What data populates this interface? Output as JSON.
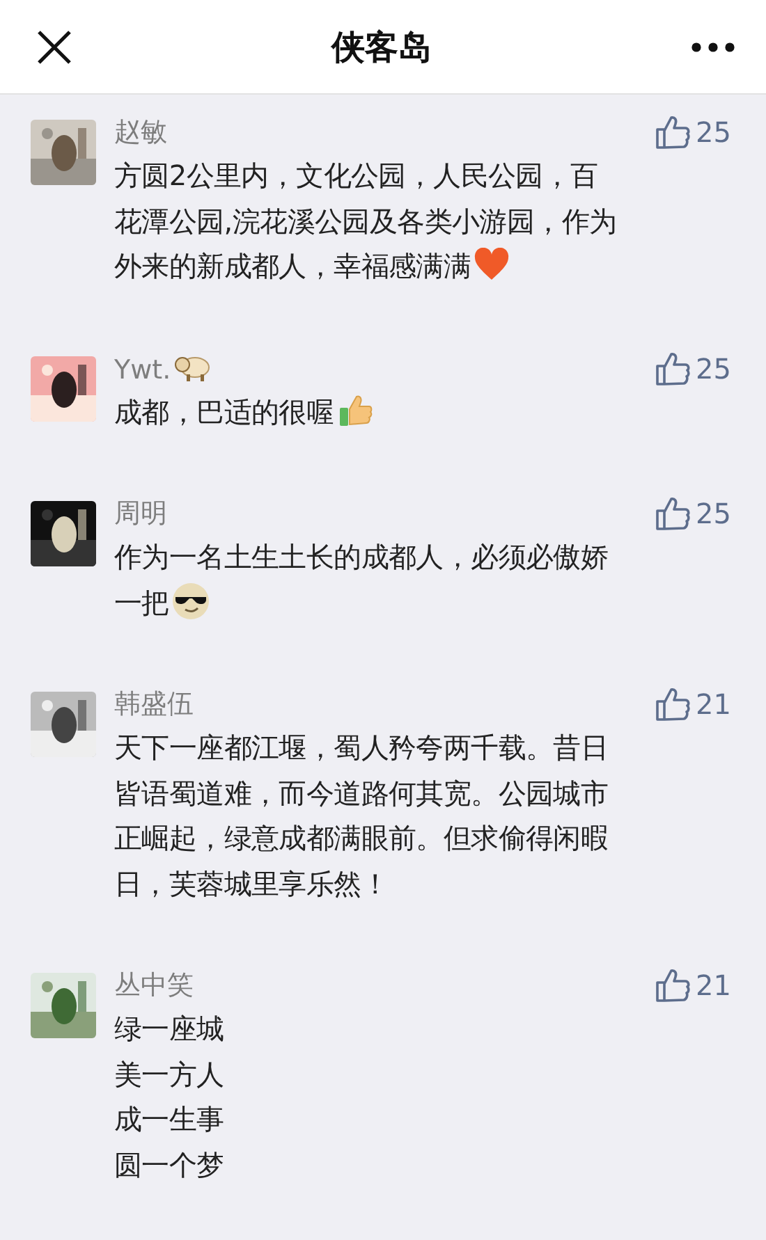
{
  "header": {
    "title": "侠客岛"
  },
  "comments": [
    {
      "name": "赵敏",
      "likes": "25",
      "lines": [
        "方圆2公里内，文化公园，人民公园，百",
        "花潭公园,浣花溪公园及各类小游园，作为",
        "外来的新成都人，幸福感满满"
      ],
      "trailing": {
        "kind": "heart"
      }
    },
    {
      "name": "Ywt.",
      "name_badge": {
        "kind": "sheep"
      },
      "likes": "25",
      "lines": [
        "成都，巴适的很喔"
      ],
      "trailing": {
        "kind": "thumbs-up"
      }
    },
    {
      "name": "周明",
      "likes": "25",
      "lines": [
        "作为一名土生土长的成都人，必须必傲娇",
        "一把"
      ],
      "trailing": {
        "kind": "sunglasses"
      }
    },
    {
      "name": "韩盛伍",
      "likes": "21",
      "lines": [
        "天下一座都江堰，蜀人矜夸两千载。昔日",
        "皆语蜀道难，而今道路何其宽。公园城市",
        "正崛起，绿意成都满眼前。但求偷得闲暇",
        "日，芙蓉城里享乐然！"
      ]
    },
    {
      "name": "丛中笑",
      "likes": "21",
      "lines": [
        "绿一座城",
        "美一方人",
        "成一生事",
        "圆一个梦"
      ]
    }
  ]
}
